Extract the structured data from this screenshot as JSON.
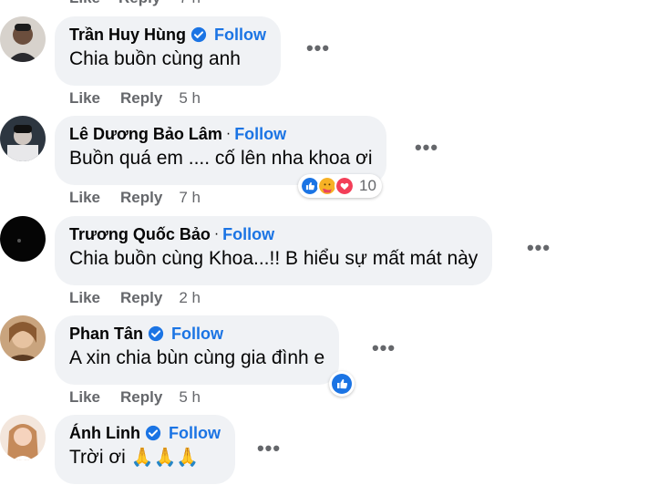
{
  "top_actions": {
    "like": "Like",
    "reply": "Reply",
    "time": "7 h"
  },
  "comments": [
    {
      "name": "Trần Huy Hùng",
      "verified": true,
      "follow": "Follow",
      "text": "Chia buồn cùng anh",
      "actions": {
        "like": "Like",
        "reply": "Reply",
        "time": "5 h"
      }
    },
    {
      "name": "Lê Dương Bảo Lâm",
      "verified": false,
      "separator": "·",
      "follow": "Follow",
      "text": "Buồn quá em .... cố lên nha khoa ơi",
      "reactions": {
        "icons": [
          "like-reaction",
          "care-reaction",
          "love-reaction"
        ],
        "count": "10"
      },
      "actions": {
        "like": "Like",
        "reply": "Reply",
        "time": "7 h"
      }
    },
    {
      "name": "Trương Quốc Bảo",
      "verified": false,
      "separator": "·",
      "follow": "Follow",
      "text": "Chia buồn cùng Khoa...!! B hiểu sự mất mát này",
      "actions": {
        "like": "Like",
        "reply": "Reply",
        "time": "2 h"
      }
    },
    {
      "name": "Phan Tân",
      "verified": true,
      "follow": "Follow",
      "text": "A xin chia bùn cùng gia đình e",
      "reactions": {
        "icons": [
          "like-reaction"
        ]
      },
      "actions": {
        "like": "Like",
        "reply": "Reply",
        "time": "5 h"
      }
    },
    {
      "name": "Ánh Linh",
      "verified": true,
      "follow": "Follow",
      "text": "Trời ơi",
      "emoji": "🙏🙏🙏"
    }
  ],
  "more_label": "•••",
  "colors": {
    "follow": "#1b74e4",
    "bubble": "#f0f2f5",
    "meta": "#65676b",
    "verified": "#1b74e4"
  }
}
